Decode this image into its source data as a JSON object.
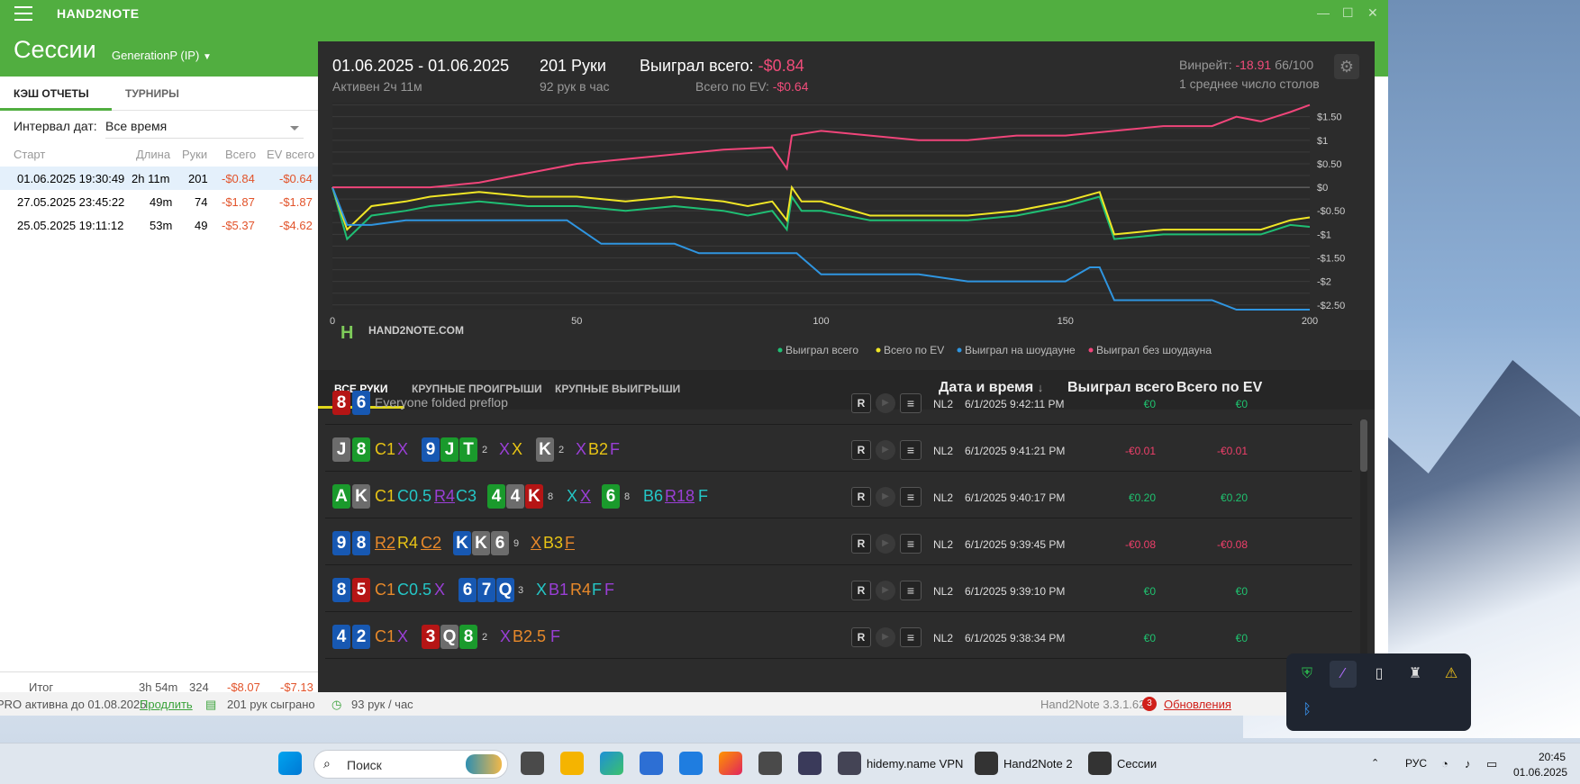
{
  "app_title": "HAND2NOTE",
  "page_title": "Сессии",
  "account": "GenerationP (IP)",
  "window_controls": [
    "minimize-icon",
    "maximize-icon",
    "close-icon"
  ],
  "left_tabs": [
    "КЭШ ОТЧЕТЫ",
    "ТУРНИРЫ"
  ],
  "interval_label": "Интервал дат:",
  "interval_value": "Все время",
  "session_headers": [
    "Старт",
    "Длина",
    "Руки",
    "Всего",
    "EV всего"
  ],
  "sessions": [
    {
      "start": "01.06.2025 19:30:49",
      "length": "2h 11m",
      "hands": "201",
      "total": "-$0.84",
      "ev": "-$0.64"
    },
    {
      "start": "27.05.2025 23:45:22",
      "length": "49m",
      "hands": "74",
      "total": "-$1.87",
      "ev": "-$1.87"
    },
    {
      "start": "25.05.2025 19:11:12",
      "length": "53m",
      "hands": "49",
      "total": "-$5.37",
      "ev": "-$4.62"
    }
  ],
  "summary": {
    "label": "Итог",
    "length": "3h 54m",
    "hands": "324",
    "total": "-$8.07",
    "ev": "-$7.13"
  },
  "status": {
    "pro": "PRO активна до 01.08.2025",
    "extend": "Продлить",
    "played": "201 рук сыграно",
    "rate": "93 рук / час",
    "version": "Hand2Note 3.3.1.62",
    "updates_count": "3",
    "updates": "Обновления"
  },
  "session_header": {
    "dates": "01.06.2025 - 01.06.2025",
    "active": "Активен 2ч 11м",
    "hands": "201 Руки",
    "hands_rate": "92 рук в час",
    "won_label": "Выиграл всего:",
    "won_value": "-$0.84",
    "ev_label": "Всего по EV:",
    "ev_value": "-$0.64",
    "winrate_label": "Винрейт:",
    "winrate_value": "-18.91",
    "winrate_unit": "б6/100",
    "tables": "1 среднее число столов"
  },
  "watermark": "HAND2NOTE.COM",
  "chart_data": {
    "type": "line",
    "xlim": [
      0,
      200
    ],
    "ylim": [
      -2.5,
      1.5
    ],
    "x_ticks": [
      "0",
      "50",
      "100",
      "150",
      "200"
    ],
    "y_ticks": [
      "$1.50",
      "$1",
      "$0.50",
      "$0",
      "-$0.50",
      "-$1",
      "-$1.50",
      "-$2",
      "-$2.50"
    ],
    "legend_position": "bottom-right",
    "series": [
      {
        "name": "Выиграл всего",
        "color": "#1fbf74",
        "x": [
          0,
          3,
          8,
          15,
          20,
          30,
          40,
          50,
          60,
          70,
          80,
          85,
          90,
          93,
          94,
          96,
          100,
          110,
          120,
          130,
          140,
          150,
          157,
          160,
          170,
          180,
          190,
          196,
          200
        ],
        "y": [
          0,
          -1.1,
          -0.6,
          -0.5,
          -0.4,
          -0.3,
          -0.4,
          -0.4,
          -0.5,
          -0.4,
          -0.5,
          -0.6,
          -0.5,
          -0.9,
          -0.2,
          -0.5,
          -0.5,
          -0.7,
          -0.7,
          -0.7,
          -0.6,
          -0.4,
          -0.2,
          -1.1,
          -1.0,
          -1.0,
          -1.0,
          -0.8,
          -0.84
        ]
      },
      {
        "name": "Всего по EV",
        "color": "#f0e626",
        "x": [
          0,
          3,
          8,
          15,
          20,
          30,
          40,
          50,
          60,
          70,
          80,
          85,
          90,
          93,
          94,
          96,
          100,
          110,
          120,
          130,
          140,
          150,
          157,
          160,
          170,
          180,
          190,
          196,
          200
        ],
        "y": [
          0,
          -0.9,
          -0.4,
          -0.3,
          -0.2,
          -0.1,
          -0.2,
          -0.2,
          -0.3,
          -0.2,
          -0.3,
          -0.4,
          -0.3,
          -0.7,
          0,
          -0.3,
          -0.3,
          -0.6,
          -0.6,
          -0.6,
          -0.5,
          -0.3,
          -0.1,
          -1.0,
          -0.9,
          -0.9,
          -0.9,
          -0.7,
          -0.64
        ]
      },
      {
        "name": "Выиграл на шоудауне",
        "color": "#2f95e0",
        "x": [
          0,
          3,
          8,
          15,
          20,
          30,
          40,
          48,
          55,
          70,
          75,
          80,
          95,
          100,
          120,
          130,
          140,
          150,
          155,
          157,
          160,
          170,
          180,
          185,
          200
        ],
        "y": [
          0,
          -0.8,
          -0.8,
          -0.7,
          -0.7,
          -0.7,
          -0.7,
          -0.7,
          -1.2,
          -1.2,
          -1.4,
          -1.4,
          -1.4,
          -1.85,
          -1.85,
          -2.0,
          -2.0,
          -2.0,
          -1.7,
          -1.7,
          -2.4,
          -2.4,
          -2.4,
          -2.6,
          -2.6
        ]
      },
      {
        "name": "Выиграл без шоудауна",
        "color": "#f0457a",
        "x": [
          0,
          10,
          20,
          30,
          40,
          50,
          60,
          70,
          80,
          90,
          93,
          94,
          100,
          110,
          120,
          130,
          140,
          150,
          160,
          170,
          180,
          185,
          190,
          196,
          200
        ],
        "y": [
          0,
          0,
          0,
          0.1,
          0.3,
          0.5,
          0.6,
          0.7,
          0.8,
          0.85,
          0.4,
          1.1,
          1.2,
          1.1,
          1.0,
          1.0,
          1.1,
          1.1,
          1.2,
          1.3,
          1.3,
          1.5,
          1.4,
          1.6,
          1.75
        ]
      }
    ]
  },
  "hands_tabs": [
    "ВСЕ РУКИ",
    "КРУПНЫЕ ПРОИГРЫШИ",
    "КРУПНЫЕ ВЫИГРЫШИ"
  ],
  "hands_columns": {
    "date": "Дата и время",
    "sort": "↓",
    "won": "Выиграл всего",
    "ev": "Всего по EV"
  },
  "hands": [
    {
      "cards": [
        {
          "r": "8",
          "s": "h"
        },
        {
          "r": "6",
          "s": "d"
        }
      ],
      "actions": [
        {
          "t": "Everyone folded preflop",
          "c": "#aaaaaa",
          "x": 55,
          "fs": 14
        }
      ],
      "board": [],
      "stake": "NL2",
      "date": "6/1/2025 9:42:11 PM",
      "won": "€0",
      "ev": "€0",
      "won_class": "pos"
    },
    {
      "cards": [
        {
          "r": "J",
          "s": "s"
        },
        {
          "r": "8",
          "s": "c"
        }
      ],
      "actions": [
        {
          "t": "C1",
          "c": "#e8c415",
          "x": 55
        },
        {
          "t": "X",
          "c": "#9a3fd6",
          "x": 80
        },
        {
          "t": "X",
          "c": "#9a3fd6",
          "x": 193
        },
        {
          "t": "X",
          "c": "#e8c415",
          "x": 207
        },
        {
          "t": "X",
          "c": "#9a3fd6",
          "x": 278
        },
        {
          "t": "B2",
          "c": "#e8c415",
          "x": 292
        },
        {
          "t": "F",
          "c": "#9a3fd6",
          "x": 316
        }
      ],
      "board": [
        {
          "r": "9",
          "s": "d",
          "x": 107
        },
        {
          "r": "J",
          "s": "c",
          "x": 128
        },
        {
          "r": "T",
          "s": "c",
          "x": 149
        },
        {
          "r": "K",
          "s": "s",
          "x": 234
        }
      ],
      "sups": [
        {
          "t": "2",
          "x": 174
        },
        {
          "t": "2",
          "x": 259
        }
      ],
      "stake": "NL2",
      "date": "6/1/2025 9:41:21 PM",
      "won": "-€0.01",
      "ev": "-€0.01",
      "won_class": "ng"
    },
    {
      "cards": [
        {
          "r": "A",
          "s": "c"
        },
        {
          "r": "K",
          "s": "s"
        }
      ],
      "actions": [
        {
          "t": "C1",
          "c": "#e8c415",
          "x": 55
        },
        {
          "t": "C0.5",
          "c": "#24c6c6",
          "x": 80
        },
        {
          "t": "R4",
          "c": "#9a3fd6",
          "x": 121,
          "u": true
        },
        {
          "t": "C3",
          "c": "#24c6c6",
          "x": 145
        },
        {
          "t": "X",
          "c": "#24c6c6",
          "x": 268
        },
        {
          "t": "X",
          "c": "#9a3fd6",
          "x": 283,
          "u": true
        },
        {
          "t": "B6",
          "c": "#24c6c6",
          "x": 353
        },
        {
          "t": "R18",
          "c": "#9a3fd6",
          "x": 377,
          "u": true
        },
        {
          "t": "F",
          "c": "#24c6c6",
          "x": 414
        }
      ],
      "board": [
        {
          "r": "4",
          "s": "c",
          "x": 180
        },
        {
          "r": "4",
          "s": "s",
          "x": 201
        },
        {
          "r": "K",
          "s": "h",
          "x": 222
        },
        {
          "r": "6",
          "s": "c",
          "x": 307
        }
      ],
      "sups": [
        {
          "t": "8",
          "x": 247
        },
        {
          "t": "8",
          "x": 332
        }
      ],
      "stake": "NL2",
      "date": "6/1/2025 9:40:17 PM",
      "won": "€0.20",
      "ev": "€0.20",
      "won_class": "pos"
    },
    {
      "cards": [
        {
          "r": "9",
          "s": "d"
        },
        {
          "r": "8",
          "s": "d"
        }
      ],
      "actions": [
        {
          "t": "R2",
          "c": "#e8892a",
          "x": 55,
          "u": true
        },
        {
          "t": "R4",
          "c": "#e8c415",
          "x": 80
        },
        {
          "t": "C2",
          "c": "#e8892a",
          "x": 106,
          "u": true
        },
        {
          "t": "X",
          "c": "#e8892a",
          "x": 228,
          "u": true
        },
        {
          "t": "B3",
          "c": "#e8c415",
          "x": 242
        },
        {
          "t": "F",
          "c": "#e8892a",
          "x": 266,
          "u": true
        }
      ],
      "board": [
        {
          "r": "K",
          "s": "d",
          "x": 142
        },
        {
          "r": "K",
          "s": "s",
          "x": 163
        },
        {
          "r": "6",
          "s": "s",
          "x": 184
        }
      ],
      "sups": [
        {
          "t": "9",
          "x": 209
        }
      ],
      "stake": "NL2",
      "date": "6/1/2025 9:39:45 PM",
      "won": "-€0.08",
      "ev": "-€0.08",
      "won_class": "ng"
    },
    {
      "cards": [
        {
          "r": "8",
          "s": "d"
        },
        {
          "r": "5",
          "s": "h"
        }
      ],
      "actions": [
        {
          "t": "C1",
          "c": "#e8892a",
          "x": 55
        },
        {
          "t": "C0.5",
          "c": "#24c6c6",
          "x": 80
        },
        {
          "t": "X",
          "c": "#9a3fd6",
          "x": 121
        },
        {
          "t": "X",
          "c": "#24c6c6",
          "x": 234
        },
        {
          "t": "B1",
          "c": "#9a3fd6",
          "x": 248
        },
        {
          "t": "R4",
          "c": "#e8892a",
          "x": 272
        },
        {
          "t": "F",
          "c": "#24c6c6",
          "x": 296
        },
        {
          "t": "F",
          "c": "#9a3fd6",
          "x": 310
        }
      ],
      "board": [
        {
          "r": "6",
          "s": "d",
          "x": 148
        },
        {
          "r": "7",
          "s": "d",
          "x": 169
        },
        {
          "r": "Q",
          "s": "d",
          "x": 190
        }
      ],
      "sups": [
        {
          "t": "3",
          "x": 214
        }
      ],
      "stake": "NL2",
      "date": "6/1/2025 9:39:10 PM",
      "won": "€0",
      "ev": "€0",
      "won_class": "pos"
    },
    {
      "cards": [
        {
          "r": "4",
          "s": "d"
        },
        {
          "r": "2",
          "s": "d"
        }
      ],
      "actions": [
        {
          "t": "C1",
          "c": "#e8892a",
          "x": 55
        },
        {
          "t": "X",
          "c": "#9a3fd6",
          "x": 80
        },
        {
          "t": "X",
          "c": "#9a3fd6",
          "x": 194
        },
        {
          "t": "B2.5",
          "c": "#e8892a",
          "x": 208
        },
        {
          "t": "F",
          "c": "#9a3fd6",
          "x": 250
        }
      ],
      "board": [
        {
          "r": "3",
          "s": "h",
          "x": 107
        },
        {
          "r": "Q",
          "s": "s",
          "x": 128
        },
        {
          "r": "8",
          "s": "c",
          "x": 149
        }
      ],
      "sups": [
        {
          "t": "2",
          "x": 174
        }
      ],
      "stake": "NL2",
      "date": "6/1/2025 9:38:34 PM",
      "won": "€0",
      "ev": "€0",
      "won_class": "pos"
    }
  ],
  "tray_icons": [
    "shield-icon",
    "feather-icon",
    "usb-icon",
    "printer-icon",
    "defender-warning-icon",
    "bluetooth-icon"
  ],
  "taskbar": {
    "search": "Поиск",
    "apps": [
      "hidemy.name VPN",
      "Hand2Note 2",
      "Сессии"
    ],
    "lang": "РУС",
    "time": "20:45",
    "date": "01.06.2025"
  }
}
